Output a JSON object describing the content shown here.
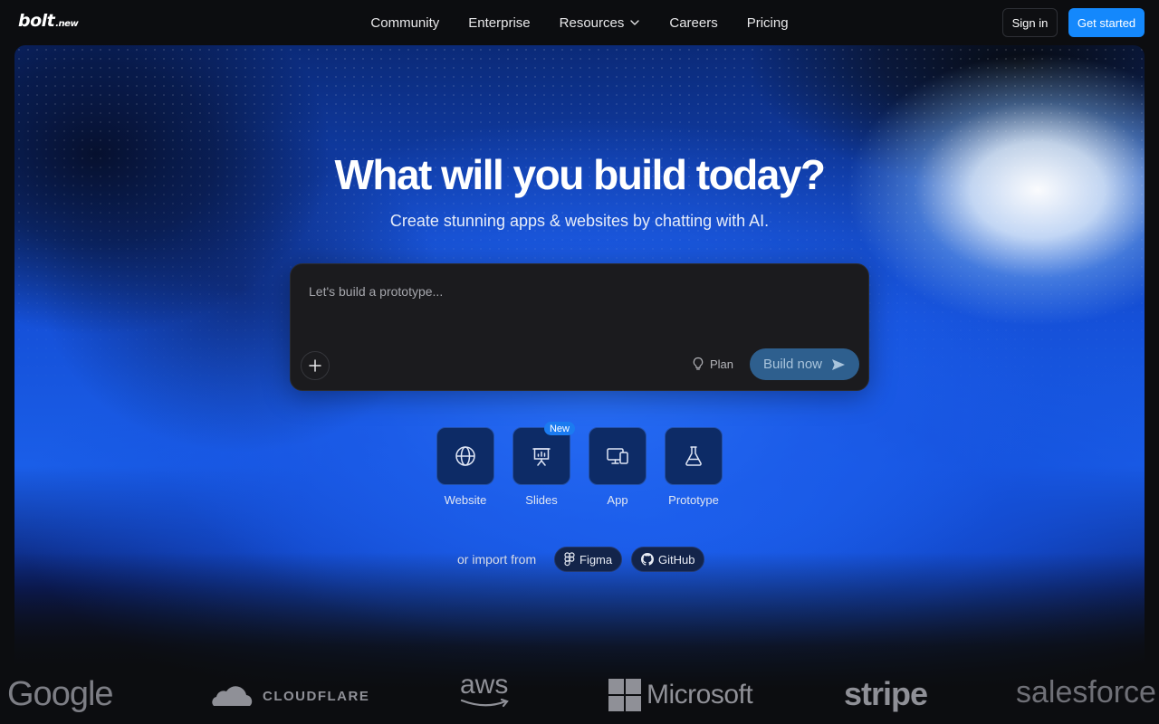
{
  "brand": {
    "logo_main": "bolt",
    "logo_sub": ".new"
  },
  "nav": {
    "items": [
      {
        "label": "Community"
      },
      {
        "label": "Enterprise"
      },
      {
        "label": "Resources"
      },
      {
        "label": "Careers"
      },
      {
        "label": "Pricing"
      }
    ]
  },
  "header": {
    "signin_label": "Sign in",
    "getstarted_label": "Get started"
  },
  "hero": {
    "title": "What will you build today?",
    "subtitle": "Create stunning apps & websites by chatting with AI."
  },
  "prompt": {
    "placeholder": "Let's build a prototype...",
    "value": "",
    "plan_label": "Plan",
    "build_label": "Build now"
  },
  "templates": [
    {
      "label": "Website",
      "icon": "globe-icon"
    },
    {
      "label": "Slides",
      "icon": "presentation-icon",
      "badge": "New"
    },
    {
      "label": "App",
      "icon": "devices-icon"
    },
    {
      "label": "Prototype",
      "icon": "flask-icon"
    }
  ],
  "import": {
    "label": "or import from",
    "figma_label": "Figma",
    "github_label": "GitHub"
  },
  "logos": [
    "Google",
    "CLOUDFLARE",
    "aws",
    "Microsoft",
    "stripe",
    "salesforce"
  ],
  "colors": {
    "accent": "#1488fc",
    "build_button": "#2e5f8e",
    "tile_bg": "#0d2b66"
  }
}
